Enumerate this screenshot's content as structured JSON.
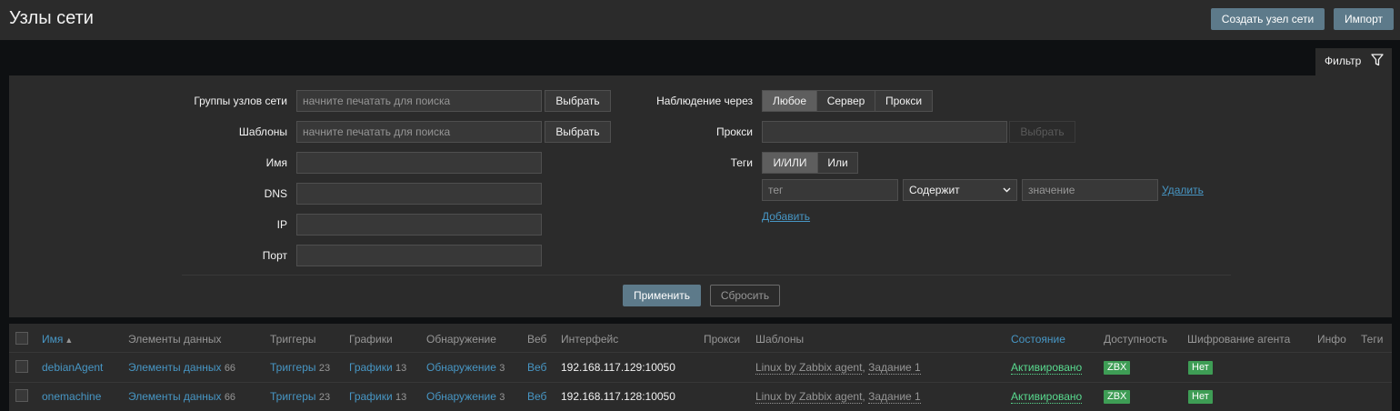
{
  "header": {
    "title": "Узлы сети",
    "create_button": "Создать узел сети",
    "import_button": "Импорт"
  },
  "filter": {
    "tab_label": "Фильтр",
    "host_groups": {
      "label": "Группы узлов сети",
      "placeholder": "начните печатать для поиска",
      "select": "Выбрать"
    },
    "templates": {
      "label": "Шаблоны",
      "placeholder": "начните печатать для поиска",
      "select": "Выбрать"
    },
    "name": {
      "label": "Имя",
      "value": ""
    },
    "dns": {
      "label": "DNS",
      "value": ""
    },
    "ip": {
      "label": "IP",
      "value": ""
    },
    "port": {
      "label": "Порт",
      "value": ""
    },
    "monitored_by": {
      "label": "Наблюдение через",
      "options": [
        "Любое",
        "Сервер",
        "Прокси"
      ],
      "selected": "Любое"
    },
    "proxy": {
      "label": "Прокси",
      "select": "Выбрать"
    },
    "tags": {
      "label": "Теги",
      "options": [
        "И/ИЛИ",
        "Или"
      ],
      "selected": "И/ИЛИ",
      "tag_placeholder": "тег",
      "operator": "Содержит",
      "value_placeholder": "значение",
      "remove": "Удалить",
      "add": "Добавить"
    },
    "apply": "Применить",
    "reset": "Сбросить"
  },
  "table": {
    "columns": {
      "name": "Имя",
      "items": "Элементы данных",
      "triggers": "Триггеры",
      "graphs": "Графики",
      "discovery": "Обнаружение",
      "web": "Веб",
      "interface": "Интерфейс",
      "proxy": "Прокси",
      "templates": "Шаблоны",
      "status": "Состояние",
      "availability": "Доступность",
      "encryption": "Шифрование агента",
      "info": "Инфо",
      "tags": "Теги"
    },
    "sort_arrow": "▲",
    "rows": [
      {
        "name": "debianAgent",
        "items": "Элементы данных",
        "items_count": "66",
        "triggers": "Триггеры",
        "triggers_count": "23",
        "graphs": "Графики",
        "graphs_count": "13",
        "discovery": "Обнаружение",
        "discovery_count": "3",
        "web": "Веб",
        "interface": "192.168.117.129:10050",
        "template1": "Linux by Zabbix agent",
        "template_sep": ",",
        "template2": "Задание 1",
        "status": "Активировано",
        "availability": "ZBX",
        "encryption": "Нет"
      },
      {
        "name": "onemachine",
        "items": "Элементы данных",
        "items_count": "66",
        "triggers": "Триггеры",
        "triggers_count": "23",
        "graphs": "Графики",
        "graphs_count": "13",
        "discovery": "Обнаружение",
        "discovery_count": "3",
        "web": "Веб",
        "interface": "192.168.117.128:10050",
        "template1": "Linux by Zabbix agent",
        "template_sep": ",",
        "template2": "Задание 1",
        "status": "Активировано",
        "availability": "ZBX",
        "encryption": "Нет"
      }
    ]
  },
  "colors": {
    "accent_link": "#4796c4",
    "status_green": "#59db8f",
    "badge_green": "#3e9d55",
    "button": "#5d7a8a"
  }
}
